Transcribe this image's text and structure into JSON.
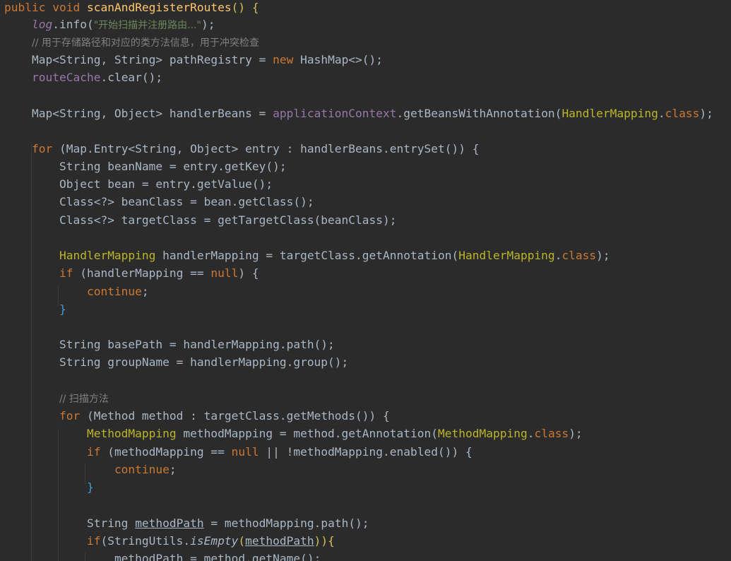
{
  "code": {
    "l01": {
      "kw_public": "public",
      "kw_void": "void",
      "method_name": "scanAndRegisterRoutes",
      "open": "() {"
    },
    "l02": {
      "field": "log",
      "call": ".info(",
      "string": "\"开始扫描并注册路由...\"",
      "end": ");"
    },
    "l03": {
      "comment": "// 用于存储路径和对应的类方法信息，用于冲突检查"
    },
    "l04": {
      "decl": "Map<String, String> pathRegistry = ",
      "kw_new": "new",
      "rest": " HashMap<>();"
    },
    "l05": {
      "field": "routeCache",
      "rest": ".clear();"
    },
    "l07": {
      "decl": "Map<String, Object> handlerBeans = ",
      "field": "applicationContext",
      "call": ".getBeansWithAnnotation(",
      "anno": "HandlerMapping",
      "dot": ".",
      "kw_class": "class",
      "end": ");"
    },
    "l09": {
      "kw_for": "for",
      "rest": " (Map.Entry<String, Object> entry : handlerBeans.entrySet()) {"
    },
    "l10": {
      "text": "String beanName = entry.getKey();"
    },
    "l11": {
      "text": "Object bean = entry.getValue();"
    },
    "l12": {
      "text": "Class<?> beanClass = bean.getClass();"
    },
    "l13": {
      "text": "Class<?> targetClass = getTargetClass(beanClass);"
    },
    "l15": {
      "anno": "HandlerMapping",
      "mid": " handlerMapping = targetClass.getAnnotation(",
      "anno2": "HandlerMapping",
      "dot": ".",
      "kw_class": "class",
      "end": ");"
    },
    "l16": {
      "kw_if": "if",
      "mid": " (handlerMapping == ",
      "kw_null": "null",
      "end": ") {"
    },
    "l17": {
      "kw_continue": "continue",
      "end": ";"
    },
    "l18": {
      "text": "}"
    },
    "l20": {
      "text": "String basePath = handlerMapping.path();"
    },
    "l21": {
      "text": "String groupName = handlerMapping.group();"
    },
    "l23": {
      "comment": "// 扫描方法"
    },
    "l24": {
      "kw_for": "for",
      "rest": " (Method method : targetClass.getMethods()) {"
    },
    "l25": {
      "anno": "MethodMapping",
      "mid": " methodMapping = method.getAnnotation(",
      "anno2": "MethodMapping",
      "dot": ".",
      "kw_class": "class",
      "end": ");"
    },
    "l26": {
      "kw_if": "if",
      "mid": " (methodMapping == ",
      "kw_null": "null",
      "rest": " || !methodMapping.enabled()) {"
    },
    "l27": {
      "kw_continue": "continue",
      "end": ";"
    },
    "l28": {
      "text": "}"
    },
    "l30": {
      "type": "String ",
      "var": "methodPath",
      "rest": " = methodMapping.path();"
    },
    "l31": {
      "kw_if": "if",
      "cls": "(StringUtils.",
      "static_call": "isEmpty",
      "open": "(",
      "var": "methodPath",
      "close": ")){"
    },
    "l32": {
      "var": "methodPath",
      "rest": " = method.getName();"
    }
  }
}
